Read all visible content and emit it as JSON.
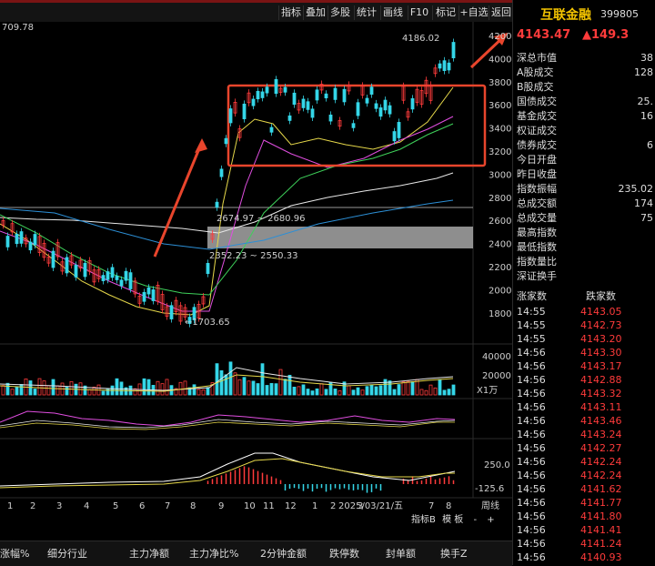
{
  "toolbar": {
    "items": [
      "指标",
      "叠加",
      "多股",
      "统计",
      "画线",
      "F10",
      "标记",
      "+自选",
      "返回"
    ]
  },
  "chart": {
    "left_top_value": "709.78",
    "y_axis_labels": [
      "4200",
      "4000",
      "3800",
      "3600",
      "3400",
      "3200",
      "3000",
      "2800",
      "2600",
      "2400",
      "2200",
      "2000",
      "1800"
    ],
    "annotations": {
      "high": "4186.02",
      "low": "←1703.65",
      "gap_upper": "2674.97 ~ 2680.96",
      "gap_lower": "2352.23 ~ 2550.33"
    },
    "volume_axis": [
      "40000",
      "20000"
    ],
    "volume_unit": "X1万",
    "macd_axis": [
      "250.0",
      "-125.6"
    ],
    "x_axis_labels": [
      "1",
      "2",
      "3",
      "4",
      "5",
      "6",
      "7",
      "8",
      "9",
      "10",
      "11",
      "12",
      "1",
      "2",
      "3",
      "2025/03/21/五",
      "7",
      "8"
    ],
    "period_label": "周线",
    "sub_toolbar": [
      "指标B",
      "模",
      "板",
      "-",
      "+"
    ]
  },
  "quote": {
    "name": "互联金融",
    "code": "399805",
    "price": "4143.47",
    "change": "▲149.3",
    "fields": [
      {
        "label": "深总市值",
        "value": "38"
      },
      {
        "label": "A股成交",
        "value": "128"
      },
      {
        "label": "B股成交",
        "value": ""
      },
      {
        "label": "国债成交",
        "value": "25."
      },
      {
        "label": "基金成交",
        "value": "16"
      },
      {
        "label": "权证成交",
        "value": ""
      },
      {
        "label": "债券成交",
        "value": "6"
      },
      {
        "label": "今日开盘",
        "value": ""
      },
      {
        "label": "昨日收盘",
        "value": ""
      },
      {
        "label": "指数振幅",
        "value": "235.02"
      },
      {
        "label": "总成交额",
        "value": "174"
      },
      {
        "label": "总成交量",
        "value": "75"
      },
      {
        "label": "最高指数",
        "value": ""
      },
      {
        "label": "最低指数",
        "value": ""
      },
      {
        "label": "指数量比",
        "value": ""
      },
      {
        "label": "深证换手",
        "value": ""
      }
    ],
    "tick_headers": [
      "涨家数",
      "跌家数"
    ],
    "ticks": [
      {
        "t": "14:55",
        "p": "4143.05"
      },
      {
        "t": "14:55",
        "p": "4142.73"
      },
      {
        "t": "14:55",
        "p": "4143.20"
      },
      {
        "t": "14:56",
        "p": "4143.30"
      },
      {
        "t": "14:56",
        "p": "4143.17"
      },
      {
        "t": "14:56",
        "p": "4142.88"
      },
      {
        "t": "14:56",
        "p": "4143.32"
      },
      {
        "t": "14:56",
        "p": "4143.11"
      },
      {
        "t": "14:56",
        "p": "4143.46"
      },
      {
        "t": "14:56",
        "p": "4143.24"
      },
      {
        "t": "14:56",
        "p": "4142.27"
      },
      {
        "t": "14:56",
        "p": "4142.24"
      },
      {
        "t": "14:56",
        "p": "4142.24"
      },
      {
        "t": "14:56",
        "p": "4141.62"
      },
      {
        "t": "14:56",
        "p": "4141.77"
      },
      {
        "t": "14:56",
        "p": "4141.80"
      },
      {
        "t": "14:56",
        "p": "4141.41"
      },
      {
        "t": "14:56",
        "p": "4141.24"
      },
      {
        "t": "14:56",
        "p": "4140.93"
      }
    ]
  },
  "bottom_columns": [
    "涨幅%",
    "细分行业",
    "主力净额",
    "主力净比%",
    "2分钟金额",
    "跌停数",
    "封单额",
    "换手Z"
  ]
}
